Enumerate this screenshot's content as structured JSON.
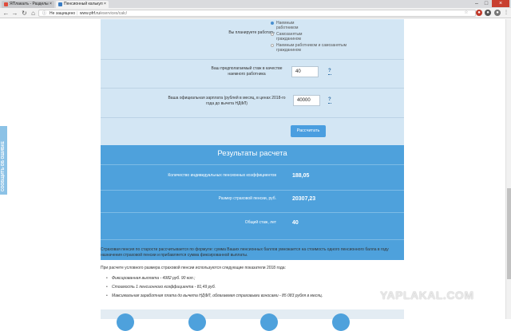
{
  "browser": {
    "tabs": [
      {
        "title": "ЯПлакалъ - Разделы ×",
        "active": false,
        "favicon_color": "#e04c3c"
      },
      {
        "title": "Пенсионный калькул ×",
        "active": true,
        "favicon_color": "#3a7cc2"
      }
    ],
    "security_label": "Не защищено",
    "url_host": "www.pfrf.ru",
    "url_path": "/eservices/calc/"
  },
  "form": {
    "work_question": "Вы планируете работать",
    "work_options": [
      {
        "label": "Наемным работником",
        "selected": true
      },
      {
        "label": "Самозанятым гражданином",
        "selected": false
      },
      {
        "label": "Наемным работником и самозанятым гражданином",
        "selected": false
      }
    ],
    "stazh_label": "Ваш предполагаемый стаж в качестве наемного работника",
    "stazh_value": "40",
    "salary_label": "Ваша официальная зарплата (рублей в месяц, в ценах 2018-го года до вычета НДФЛ)",
    "salary_value": "40000",
    "help_mark": "?",
    "calc_button": "Рассчитать"
  },
  "results": {
    "title": "Результаты расчета",
    "rows": [
      {
        "label": "Количество индивидуальных пенсионных коэффициентов",
        "value": "188,05"
      },
      {
        "label": "Размер страховой пенсии, руб.",
        "value": "20307,23"
      },
      {
        "label": "Общий стаж, лет",
        "value": "40"
      }
    ]
  },
  "info": {
    "para1": "Страховая пенсия по старости рассчитывается по формуле: сумма Ваших пенсионных баллов умножается на стоимость одного пенсионного балла в году назначения страховой пенсии и прибавляется сумма фиксированной выплаты.",
    "para2": "При расчете условного размера страховой пенсии используются следующие показатели 2018 года:",
    "items": [
      "Фиксированная выплата - 4982 руб. 90 коп.;",
      "Стоимость 1 пенсионного коэффициента - 81,49 руб.",
      "Максимальная заработная плата до вычета НДФЛ, облагаемая страховыми взносами - 85 083 рубля в месяц."
    ]
  },
  "side_tab": "СООБЩИТЬ ОБ ОШИБКЕ",
  "watermark": "YAPLAKAL.COM",
  "colors": {
    "form_bg": "#d3e6f4",
    "results_bg": "#4ea1dc",
    "button_bg": "#4a9ee0"
  }
}
